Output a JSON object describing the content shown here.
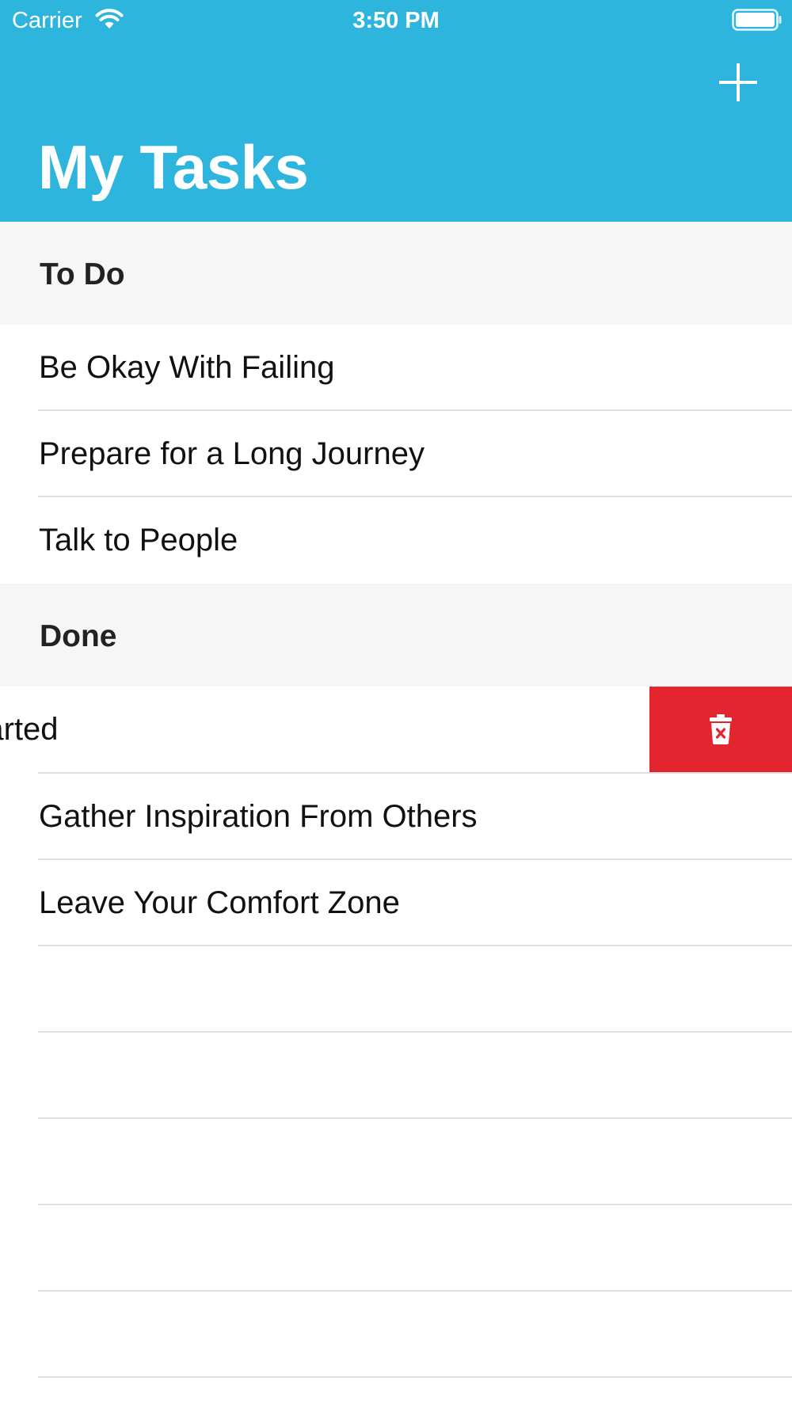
{
  "status_bar": {
    "carrier": "Carrier",
    "time": "3:50 PM",
    "wifi_icon": "wifi-icon",
    "battery_icon": "battery-full-icon"
  },
  "navbar": {
    "title": "My Tasks",
    "add_icon": "plus-icon",
    "background_color": "#2db5dd"
  },
  "sections": [
    {
      "title": "To Do",
      "rows": [
        "Be Okay With Failing",
        "Prepare for a Long Journey",
        "Talk to People"
      ]
    },
    {
      "title": "Done",
      "rows": [
        "Get Started",
        "Gather Inspiration From Others",
        "Leave Your Comfort Zone"
      ]
    }
  ],
  "swipe_action": {
    "icon": "trash-icon",
    "color": "#e2252e"
  }
}
